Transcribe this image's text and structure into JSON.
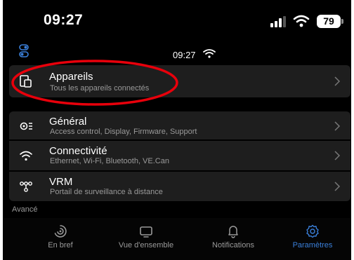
{
  "status_bar": {
    "time": "09:27",
    "battery": "79"
  },
  "app_header": {
    "clock": "09:27"
  },
  "rows": [
    {
      "title": "Appareils",
      "subtitle": "Tous les appareils connectés",
      "icon": "devices-icon"
    },
    {
      "title": "Général",
      "subtitle": "Access control, Display, Firmware, Support",
      "icon": "settings-list-icon"
    },
    {
      "title": "Connectivité",
      "subtitle": "Ethernet, Wi-Fi, Bluetooth, VE.Can",
      "icon": "wifi-icon"
    },
    {
      "title": "VRM",
      "subtitle": "Portail de surveillance à distance",
      "icon": "network-icon"
    }
  ],
  "section_label": "Avancé",
  "bottom_nav": [
    {
      "label": "En bref",
      "icon": "gauge-icon"
    },
    {
      "label": "Vue d'ensemble",
      "icon": "overview-icon"
    },
    {
      "label": "Notifications",
      "icon": "bell-icon"
    },
    {
      "label": "Paramètres",
      "icon": "gear-icon",
      "active": true
    }
  ],
  "colors": {
    "background": "#000000",
    "row": "#1e1e1e",
    "accent": "#3a7fd9",
    "annotation": "#e8000b"
  }
}
